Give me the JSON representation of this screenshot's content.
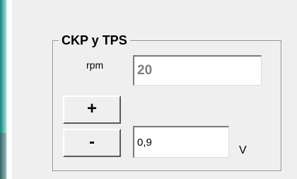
{
  "groupbox": {
    "title": "CKP y TPS"
  },
  "rpm": {
    "label": "rpm",
    "value": "20"
  },
  "buttons": {
    "increment_label": "+",
    "decrement_label": "-"
  },
  "voltage": {
    "value": "0,9",
    "unit": "V"
  }
}
